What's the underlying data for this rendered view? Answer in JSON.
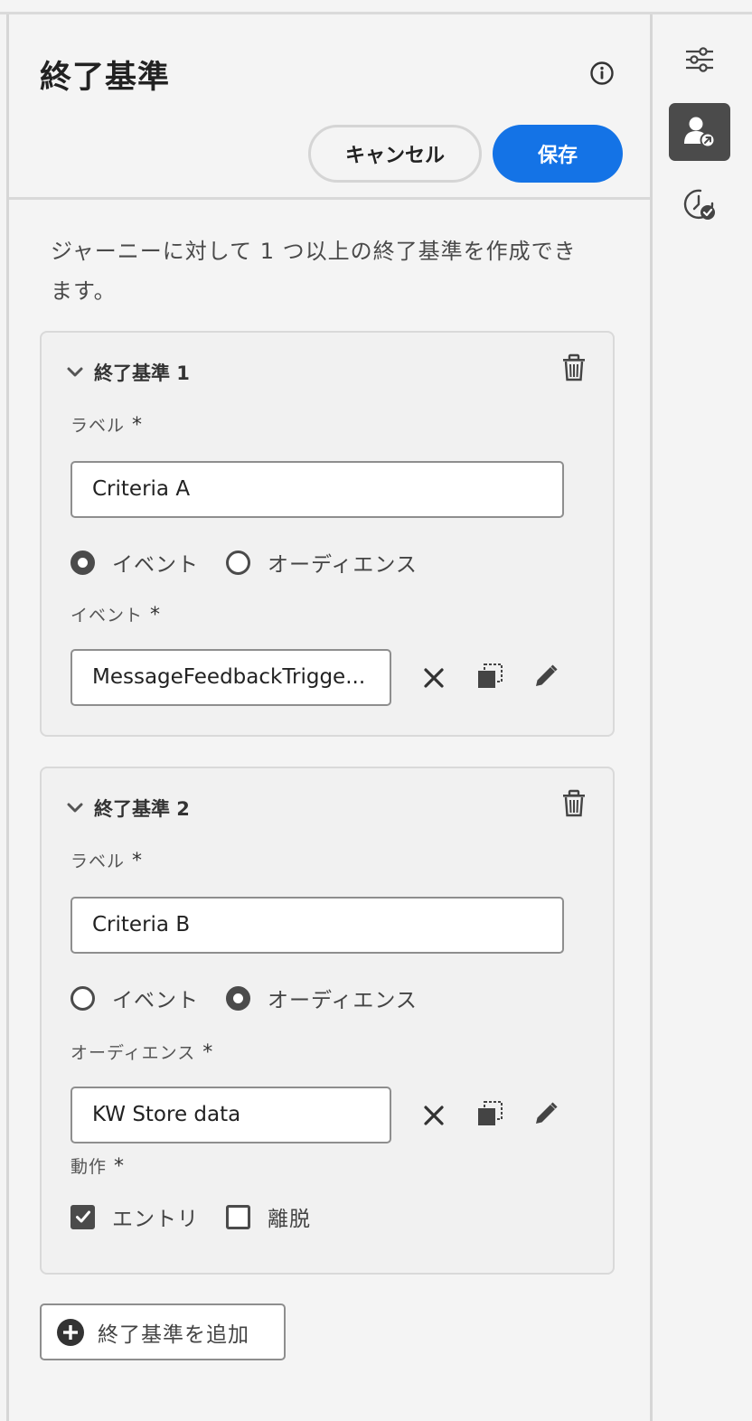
{
  "panel": {
    "title": "終了基準",
    "cancel_label": "キャンセル",
    "save_label": "保存",
    "description": "ジャーニーに対して 1 つ以上の終了基準を作成できます。"
  },
  "criteria": [
    {
      "title": "終了基準 1",
      "label_field": {
        "label": "ラベル",
        "required_mark": "*",
        "value": "Criteria A"
      },
      "type_options": [
        {
          "label": "イベント",
          "selected": true
        },
        {
          "label": "オーディエンス",
          "selected": false
        }
      ],
      "source_field": {
        "label": "イベント",
        "required_mark": "*",
        "value": "MessageFeedbackTrigge..."
      }
    },
    {
      "title": "終了基準 2",
      "label_field": {
        "label": "ラベル",
        "required_mark": "*",
        "value": "Criteria B"
      },
      "type_options": [
        {
          "label": "イベント",
          "selected": false
        },
        {
          "label": "オーディエンス",
          "selected": true
        }
      ],
      "source_field": {
        "label": "オーディエンス",
        "required_mark": "*",
        "value": "KW Store data"
      },
      "behavior": {
        "label": "動作",
        "required_mark": "*",
        "options": [
          {
            "label": "エントリ",
            "checked": true
          },
          {
            "label": "離脱",
            "checked": false
          }
        ]
      }
    }
  ],
  "add_button_label": "終了基準を追加",
  "colors": {
    "accent": "#1473e6",
    "icon": "#4b4b4b",
    "background": "#f4f4f4"
  },
  "icons": {
    "info": "info-icon",
    "collapse": "chevron-down-icon",
    "delete": "trash-icon",
    "clear": "close-icon",
    "copy": "copy-icon",
    "edit": "pencil-icon",
    "add": "plus-circle-icon",
    "rail": [
      "sliders-icon",
      "user-exit-icon",
      "clock-check-icon"
    ]
  }
}
